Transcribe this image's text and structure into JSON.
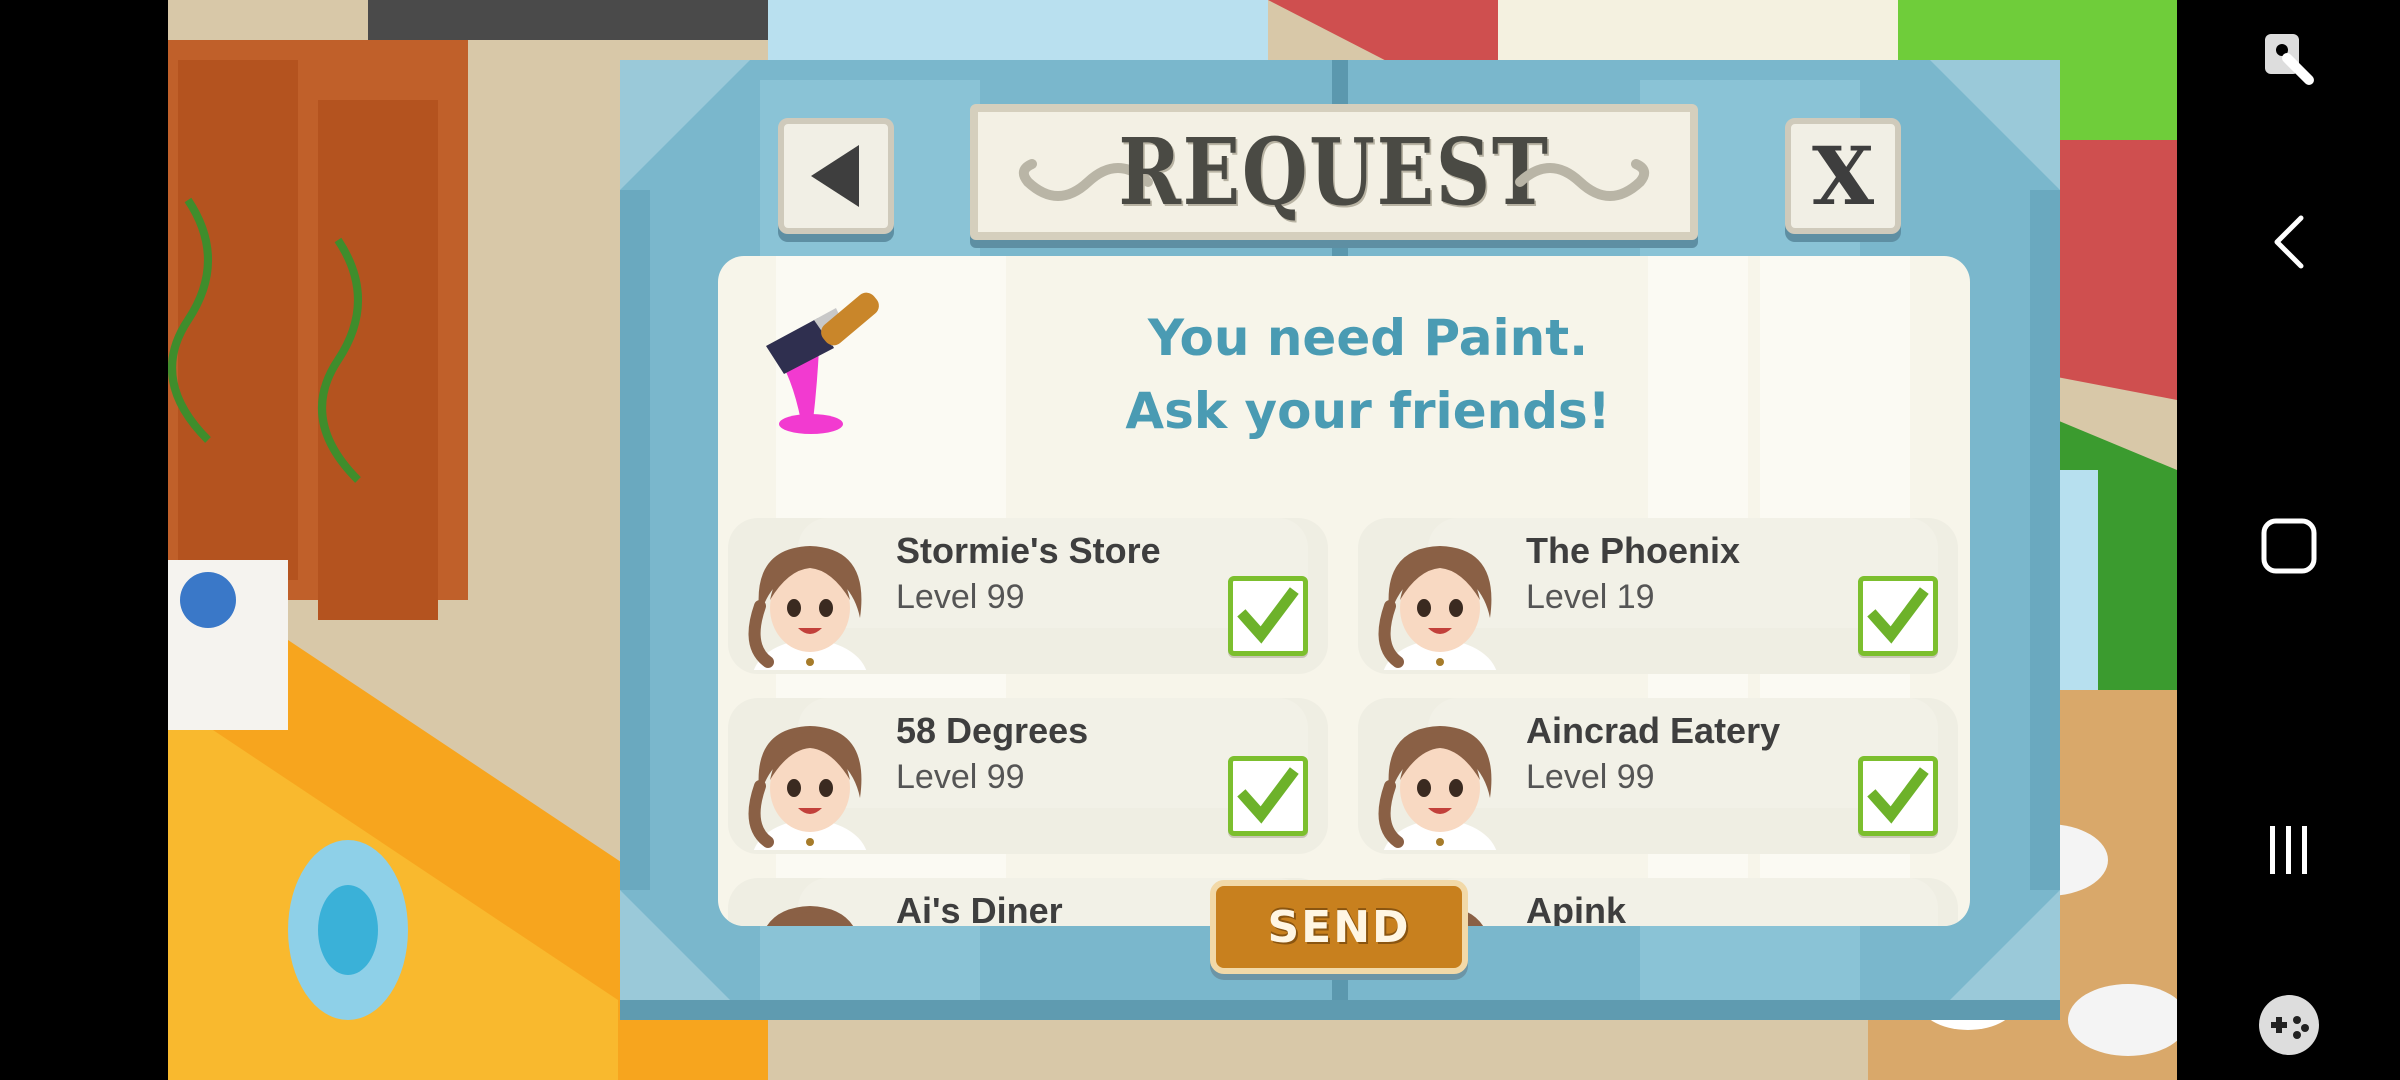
{
  "dialog": {
    "title": "REQUEST",
    "close_label": "X",
    "message_line1": "You need Paint.",
    "message_line2": "Ask your friends!",
    "send_label": "SEND"
  },
  "friends": [
    {
      "name": "Stormie's Store",
      "level": "Level 99",
      "selected": true
    },
    {
      "name": " The Phoenix",
      "level": "Level 19",
      "selected": true
    },
    {
      "name": "58 Degrees",
      "level": "Level 99",
      "selected": true
    },
    {
      "name": "Aincrad Eatery",
      "level": "Level 99",
      "selected": true
    },
    {
      "name": "Ai's Diner",
      "level": "",
      "selected": false
    },
    {
      "name": "Apink",
      "level": "",
      "selected": false
    }
  ],
  "icons": {
    "item": "paint-brush-icon",
    "back": "triangle-left-icon",
    "check": "checkmark-icon",
    "nav": [
      "accessibility-icon",
      "back-chevron-icon",
      "home-square-icon",
      "recents-icon",
      "game-tools-icon"
    ]
  },
  "colors": {
    "dialog_frame": "#7ab7cc",
    "message_text": "#4a9bb3",
    "send_button": "#c8801e",
    "checkbox_border": "#7cbf2e"
  }
}
